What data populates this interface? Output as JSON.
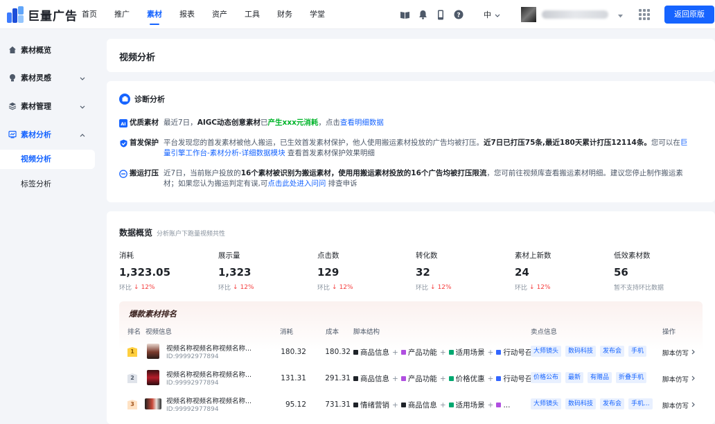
{
  "brand": {
    "name": "巨量广告"
  },
  "nav": {
    "items": [
      "首页",
      "推广",
      "素材",
      "报表",
      "资产",
      "工具",
      "财务",
      "学堂"
    ],
    "active_index": 2
  },
  "header": {
    "lang": "中",
    "back_label": "返回原版"
  },
  "sidebar": {
    "items": [
      {
        "label": "素材概览"
      },
      {
        "label": "素材灵感"
      },
      {
        "label": "素材管理"
      },
      {
        "label": "素材分析"
      }
    ],
    "sub_items": [
      "视频分析",
      "标签分析"
    ]
  },
  "page": {
    "title": "视频分析"
  },
  "diagnosis": {
    "title": "诊断分析",
    "rows": [
      {
        "tag": "优质素材",
        "t1": "最近7日，",
        "b1": "AIGC动态创意素材",
        "t2": "已",
        "g1": "产生xxx元消耗",
        "t3": "，点击",
        "l1": "查看明细数据"
      },
      {
        "tag": "首发保护",
        "t1": "平台发现您的首发素材被他人搬运，已生效首发素材保护，他人使用搬运素材投放的广告均被打压。",
        "b1": "近7日已打压75条,最近180天累计打压12114条。",
        "t2": "您可以在",
        "l1": "巨量引擎工作台-素材分析-详细数据模块",
        "t3": " 查看首发素材保护效果明细"
      },
      {
        "tag": "搬运打压",
        "t1": "近7日，当前账户投放的",
        "b1": "16个素材被识别为搬运素材，使用用搬运素材投放的16个广告均被打压限流",
        "t2": "，您可前往视频库查看搬运素材明细。建议您停止制作搬运素材；如果您认为搬运判定有误,可",
        "l1": "点击此处进入问问",
        "t3": " 排查申诉"
      }
    ]
  },
  "overview": {
    "title": "数据概览",
    "subtitle": "分析账户下跑量视频共性",
    "metrics": [
      {
        "label": "消耗",
        "value": "1,323.05",
        "cmp_label": "环比",
        "change": "12%"
      },
      {
        "label": "展示量",
        "value": "1,323",
        "cmp_label": "环比",
        "change": "12%"
      },
      {
        "label": "点击数",
        "value": "129",
        "cmp_label": "环比",
        "change": "12%"
      },
      {
        "label": "转化数",
        "value": "32",
        "cmp_label": "环比",
        "change": "12%"
      },
      {
        "label": "素材上新数",
        "value": "24",
        "cmp_label": "环比",
        "change": "12%"
      },
      {
        "label": "低效素材数",
        "value": "56",
        "cmp_label": "暂不支持环比数据",
        "change": ""
      }
    ]
  },
  "ranking": {
    "title": "爆款素材排名",
    "columns": [
      "排名",
      "视频信息",
      "消耗",
      "成本",
      "脚本结构",
      "卖点信息",
      "操作"
    ],
    "rows": [
      {
        "rank": "1",
        "name": "视频名称视频名称视频名称...",
        "id": "ID:99992977894",
        "cost": "180.32",
        "unit_cost": "180.32",
        "script": [
          {
            "label": "商品信息",
            "color": "#1f2329"
          },
          {
            "label": "产品功能",
            "color": "#b04fe0"
          },
          {
            "label": "适用场景",
            "color": "#00a870"
          },
          {
            "label": "行动号召",
            "color": "#3366ff"
          }
        ],
        "tags": [
          "大师镜头",
          "数码科技",
          "发布会",
          "手机"
        ],
        "op": "脚本仿写"
      },
      {
        "rank": "2",
        "name": "视频名称视频名称视频名称...",
        "id": "ID:99992977894",
        "cost": "131.31",
        "unit_cost": "291.31",
        "script": [
          {
            "label": "商品信息",
            "color": "#1f2329"
          },
          {
            "label": "产品功能",
            "color": "#b04fe0"
          },
          {
            "label": "价格优惠",
            "color": "#00a870"
          },
          {
            "label": "行动号召",
            "color": "#3366ff"
          }
        ],
        "tags": [
          "价格公布",
          "最新",
          "有赠品",
          "折叠手机"
        ],
        "op": "脚本仿写"
      },
      {
        "rank": "3",
        "name": "视频名称视频名称视频名称...",
        "id": "ID:99992977894",
        "cost": "95.12",
        "unit_cost": "731.31",
        "script": [
          {
            "label": "情绪营销",
            "color": "#1f2329"
          },
          {
            "label": "商品信息",
            "color": "#b04fe0"
          },
          {
            "label": "适用场景",
            "color": "#00a870"
          },
          {
            "label": "...",
            "color": "#b04fe0"
          }
        ],
        "tags": [
          "大师镜头",
          "数码科技",
          "发布会",
          "手机..."
        ],
        "op": "脚本仿写"
      }
    ]
  },
  "colors": {
    "accent": "#1664ff",
    "down": "#f53f3f",
    "success": "#00b42a"
  }
}
